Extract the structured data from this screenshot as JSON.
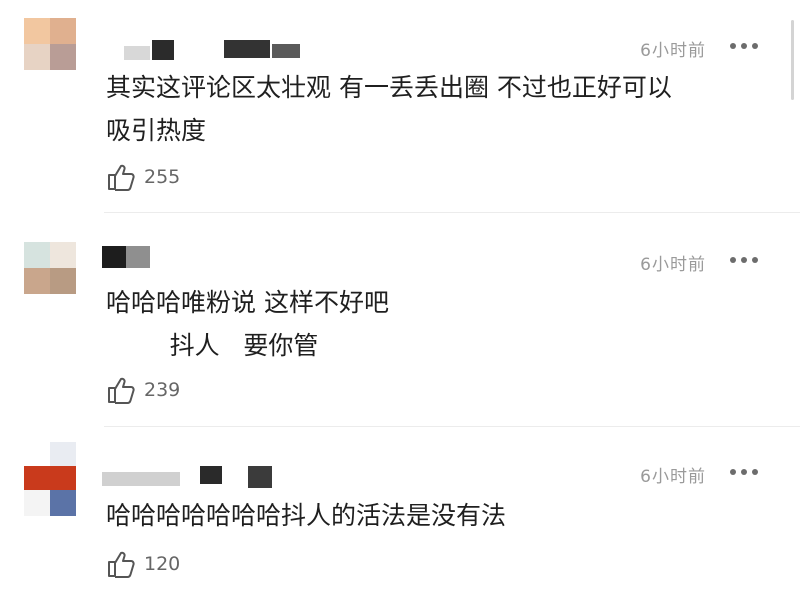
{
  "comments": [
    {
      "time": "6小时前",
      "lines": [
        "其实这评论区太壮观 有一丢丢出圈 不过也正好可以",
        "吸引热度"
      ],
      "likes": "255",
      "more_icon": "more-icon",
      "like_icon": "thumbs-up-icon",
      "avatar_colors": [
        "#f2c7a0",
        "#e7d3c4",
        "#c99a8d",
        "#b8a39c"
      ],
      "name_colors": [
        "#d9d9d9",
        "#2b2b2b",
        "#3a3a3a"
      ]
    },
    {
      "time": "6小时前",
      "lines": [
        "哈哈哈唯粉说 这样不好吧",
        "        抖人   要你管"
      ],
      "likes": "239",
      "more_icon": "more-icon",
      "like_icon": "thumbs-up-icon",
      "avatar_colors": [
        "#dde7e3",
        "#c9b5a2",
        "#b89b83",
        "#eee6dd"
      ],
      "name_colors": [
        "#1d1d1d",
        "#8f8f8f"
      ]
    },
    {
      "time": "6小时前",
      "lines": [
        "哈哈哈哈哈哈哈抖人的活法是没有法"
      ],
      "likes": "120",
      "more_icon": "more-icon",
      "like_icon": "thumbs-up-icon",
      "avatar_colors": [
        "#c93a1c",
        "#5b73a7",
        "#e9ecf2",
        "#f2f2f2"
      ],
      "name_colors": [
        "#d0d0d0",
        "#2a2a2a",
        "#3b3b3b"
      ]
    }
  ]
}
